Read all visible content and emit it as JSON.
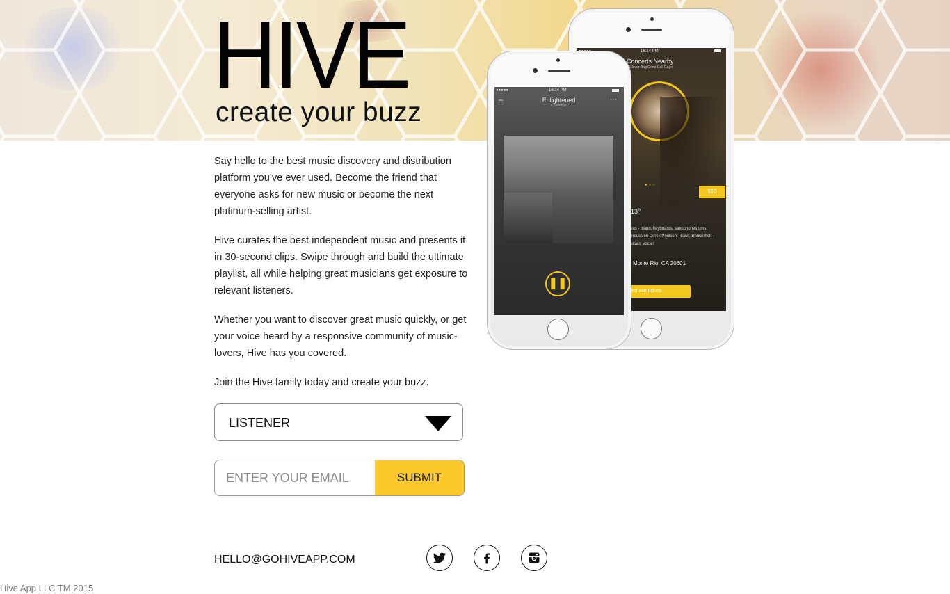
{
  "header": {
    "logo": "HIVE",
    "tagline": "create your buzz"
  },
  "intro": {
    "p1": "Say hello to the best music discovery and distribution platform you’ve ever used. Become the friend that everyone asks for new music or become the next platinum-selling artist.",
    "p2": "Hive curates the best independent music and presents it in 30-second clips. Swipe through and build the ultimate playlist, all while helping great musicians get exposure to relevant listeners.",
    "p3": "Whether you want to discover great music quickly, or get your voice heard by a responsive community of music-lovers, Hive has you covered.",
    "p4": "Join the Hive family today and create your buzz."
  },
  "form": {
    "role_value": "LISTENER",
    "email_placeholder": "ENTER YOUR EMAIL",
    "submit_label": "SUBMIT"
  },
  "footer": {
    "email": "HELLO@GOHIVEAPP.COM",
    "copyright": "Hive App LLC TM 2015",
    "social": [
      "twitter-icon",
      "facebook-icon",
      "instagram-icon"
    ]
  },
  "phone_front": {
    "time": "16:14 PM",
    "track_title": "Enlightened",
    "track_artist": "Columbus",
    "carrier": "●●●●●"
  },
  "phone_back": {
    "time": "16:14 PM",
    "heading": "Concerts Nearby",
    "subheading": "Clever Bag Gone Gull Cage",
    "price": "$10",
    "date": "13",
    "date_sup": "th",
    "lineup": "avas - piano, keyboards, saxophones ums, percussion Derek Poulson - bass, Brinkerhoff - guitars, vocals",
    "location": "Monte Rio, CA 20601",
    "cta": "urchase tickets",
    "carrier": "●●●●●"
  },
  "colors": {
    "accent": "#fbc92b",
    "text": "#222222"
  }
}
